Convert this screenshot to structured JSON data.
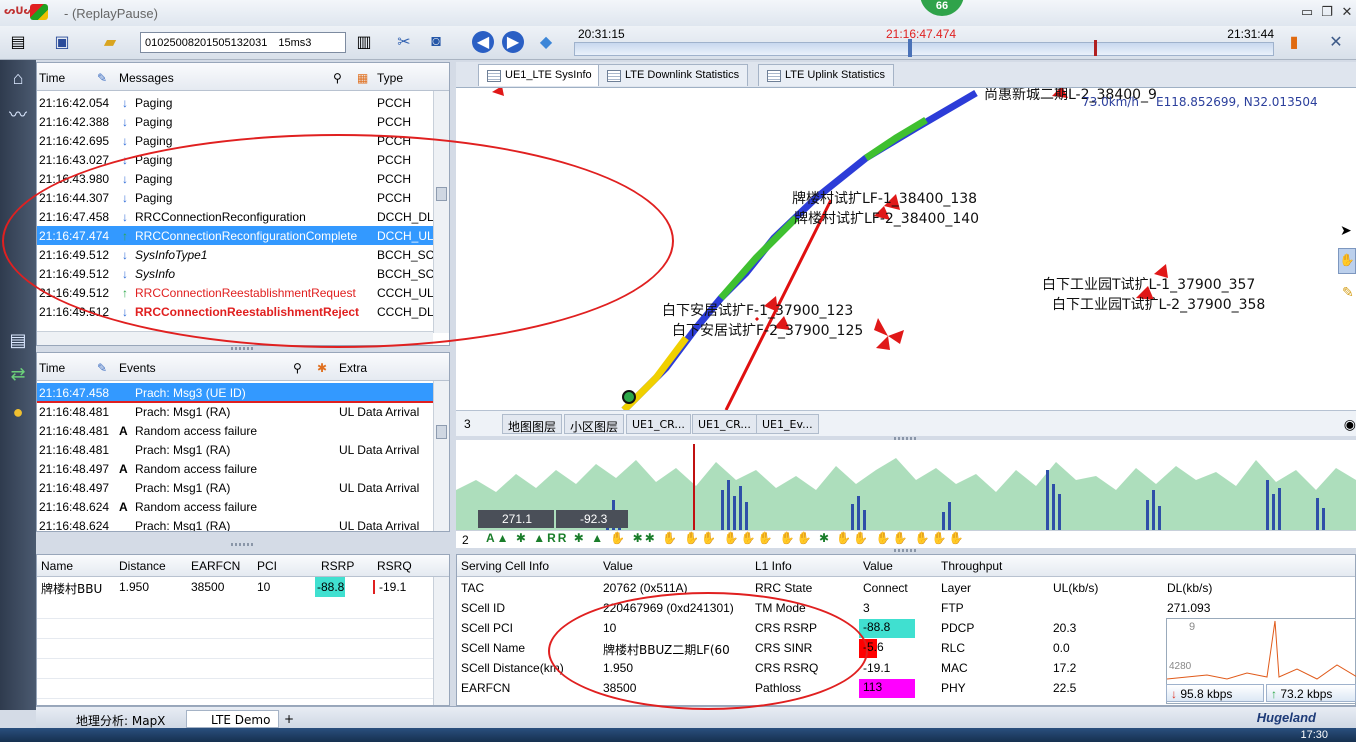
{
  "window": {
    "logo_text": "ᔕᑌᔕ",
    "title": " - (ReplayPause)",
    "badge": "66",
    "minimize": "▭",
    "restore": "❐",
    "close": "✕"
  },
  "toolbar": {
    "file_name": "01025008201505132031 15ms3",
    "timeline": {
      "start": "20:31:15",
      "current": "21:16:47.474",
      "end": "21:31:44"
    }
  },
  "messages": {
    "headers": {
      "time": "Time",
      "messages": "Messages",
      "type": "Type"
    },
    "rows": [
      {
        "time": "21:16:42.054",
        "dir": "down",
        "msg": "Paging",
        "type": "PCCH"
      },
      {
        "time": "21:16:42.388",
        "dir": "down",
        "msg": "Paging",
        "type": "PCCH"
      },
      {
        "time": "21:16:42.695",
        "dir": "down",
        "msg": "Paging",
        "type": "PCCH"
      },
      {
        "time": "21:16:43.027",
        "dir": "down",
        "msg": "Paging",
        "type": "PCCH"
      },
      {
        "time": "21:16:43.980",
        "dir": "down",
        "msg": "Paging",
        "type": "PCCH"
      },
      {
        "time": "21:16:44.307",
        "dir": "down",
        "msg": "Paging",
        "type": "PCCH"
      },
      {
        "time": "21:16:47.458",
        "dir": "down",
        "msg": "RRCConnectionReconfiguration",
        "type": "DCCH_DL"
      },
      {
        "time": "21:16:47.474",
        "dir": "up",
        "msg": "RRCConnectionReconfigurationComplete",
        "type": "DCCH_UL"
      },
      {
        "time": "21:16:49.512",
        "dir": "down",
        "msg": "SysInfoType1",
        "type": "BCCH_SC"
      },
      {
        "time": "21:16:49.512",
        "dir": "down",
        "msg": "SysInfo",
        "type": "BCCH_SC"
      },
      {
        "time": "21:16:49.512",
        "dir": "up",
        "msg": "RRCConnectionReestablishmentRequest",
        "type": "CCCH_UL"
      },
      {
        "time": "21:16:49.512",
        "dir": "down",
        "msg": "RRCConnectionReestablishmentReject",
        "type": "CCCH_DL"
      }
    ]
  },
  "events": {
    "headers": {
      "time": "Time",
      "events": "Events",
      "extra": "Extra"
    },
    "rows": [
      {
        "time": "21:16:47.458",
        "event": "Prach: Msg3 (UE ID)",
        "extra": ""
      },
      {
        "time": "21:16:48.481",
        "event": "Prach: Msg1 (RA)",
        "extra": "UL Data Arrival"
      },
      {
        "time": "21:16:48.481",
        "event": "Random access failure",
        "extra": ""
      },
      {
        "time": "21:16:48.481",
        "event": "Prach: Msg1 (RA)",
        "extra": "UL Data Arrival"
      },
      {
        "time": "21:16:48.497",
        "event": "Random access failure",
        "extra": ""
      },
      {
        "time": "21:16:48.497",
        "event": "Prach: Msg1 (RA)",
        "extra": "UL Data Arrival"
      },
      {
        "time": "21:16:48.624",
        "event": "Random access failure",
        "extra": ""
      },
      {
        "time": "21:16:48.624",
        "event": "Prach: Msg1 (RA)",
        "extra": "UL Data Arrival"
      }
    ]
  },
  "neighbors": {
    "headers": [
      "Name",
      "Distance",
      "EARFCN",
      "PCI",
      "RSRP",
      "RSRQ"
    ],
    "rows": [
      {
        "name": "牌楼村BBU",
        "distance": "1.950",
        "earfcn": "38500",
        "pci": "10",
        "rsrp": "-88.8",
        "rsrq": "-19.1"
      }
    ]
  },
  "tabs": [
    "UE1_LTE SysInfo",
    "LTE Downlink Statistics",
    "LTE Uplink Statistics"
  ],
  "map": {
    "speed": "73.0km/h",
    "coords": "E118.852699, N32.013504",
    "labels": [
      "牌楼村试扩LF-1_38400_138",
      "牌楼村试扩LF-2_38400_140",
      "白下安居试扩F-1_37900_123",
      "白下安居试扩F-2_37900_125",
      "白下工业园T试扩L-1_37900_357",
      "白下工业园T试扩L-2_37900_358",
      "尚惠新城二期L-2_38400_9"
    ],
    "layer_count": "3",
    "layer_tabs": [
      "地图图层",
      "小区图层",
      "UE1_CR...",
      "UE1_CR...",
      "UE1_Ev..."
    ]
  },
  "chart_strip": {
    "label_num": "2",
    "value_dl": "271.1",
    "value_rsrp": "-92.3"
  },
  "serving_cell": {
    "headers": [
      "Serving Cell Info",
      "Value",
      "L1 Info",
      "Value",
      "Throughput"
    ],
    "rows": [
      {
        "k": "TAC",
        "v": "20762 (0x511A)",
        "k2": "RRC State",
        "v2": "Connect"
      },
      {
        "k": "SCell ID",
        "v": "220467969 (0xd241301)",
        "k2": "TM Mode",
        "v2": "3"
      },
      {
        "k": "SCell PCI",
        "v": "10",
        "k2": "CRS RSRP",
        "v2": "-88.8"
      },
      {
        "k": "SCell Name",
        "v": "牌楼村BBUZ二期LF(60",
        "k2": "CRS SINR",
        "v2": "-5.6"
      },
      {
        "k": "SCell Distance(km)",
        "v": "1.950",
        "k2": "CRS RSRQ",
        "v2": "-19.1"
      },
      {
        "k": "EARFCN",
        "v": "38500",
        "k2": "Pathloss",
        "v2": "113"
      }
    ],
    "throughput_headers": [
      "Layer",
      "UL(kb/s)",
      "DL(kb/s)"
    ],
    "throughput": [
      {
        "layer": "FTP",
        "ul": "",
        "dl": "271.093"
      },
      {
        "layer": "PDCP",
        "ul": "20.3",
        "dl": ""
      },
      {
        "layer": "RLC",
        "ul": "0.0",
        "dl": ""
      },
      {
        "layer": "MAC",
        "ul": "17.2",
        "dl": ""
      },
      {
        "layer": "PHY",
        "ul": "22.5",
        "dl": ""
      }
    ],
    "mini_axis_top": "9",
    "mini_axis_mid": "4280",
    "down_kbps": "95.8 kbps",
    "up_kbps": "73.2 kbps"
  },
  "bottom": {
    "tab1": "地理分析: MapX",
    "tab2": "LTE Demo",
    "add": "+",
    "brand": "Hugeland",
    "clock": "17:30"
  },
  "colors": {
    "selection": "#3399ff",
    "rsrp_cell": "#40e0d0",
    "sinr_cell": "#ff0000",
    "pathloss_cell": "#ff00ff",
    "annotation": "#e02020"
  }
}
